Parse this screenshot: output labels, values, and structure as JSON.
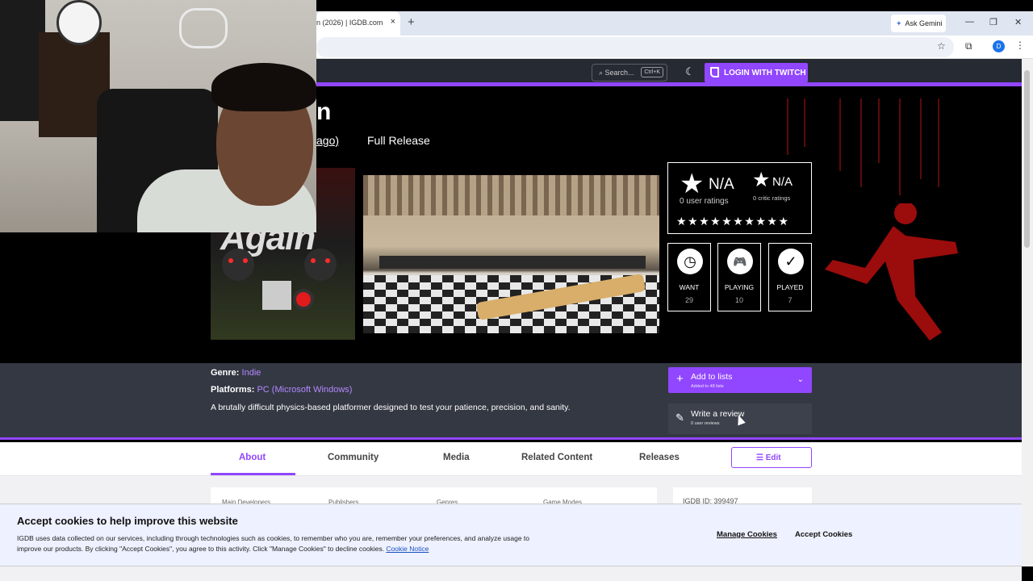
{
  "browser": {
    "tab_title": "n (2026) | IGDB.com",
    "tab_close": "×",
    "new_tab": "+",
    "gemini_label": "Ask Gemini",
    "minimize": "—",
    "restore": "❐",
    "close": "✕",
    "profile_initial": "D"
  },
  "header": {
    "search_placeholder": "Search...",
    "search_shortcut": "Ctrl+K",
    "login_label": "LOGIN WITH TWITCH"
  },
  "hero": {
    "title_fragment": "n",
    "release_fragment": "ago)",
    "release_status": "Full Release",
    "cover_text": "Again"
  },
  "ratings": {
    "user_score": "N/A",
    "user_count": "0 user ratings",
    "critic_score": "N/A",
    "critic_count": "0 critic ratings",
    "stars": "★★★★★★★★★★"
  },
  "stats": [
    {
      "label": "WANT",
      "count": "29",
      "icon": "◷"
    },
    {
      "label": "PLAYING",
      "count": "10",
      "icon": "🎮"
    },
    {
      "label": "PLAYED",
      "count": "7",
      "icon": "✓"
    }
  ],
  "info": {
    "genre_label": "Genre:",
    "genre_value": "Indie",
    "platforms_label": "Platforms:",
    "platforms_value": "PC (Microsoft Windows)",
    "description": "A brutally difficult physics-based platformer designed to test your patience, precision, and sanity.",
    "add_lists_label": "Add to lists",
    "add_lists_sub": "Added to 48 lists",
    "review_label": "Write a review",
    "review_sub": "0 user reviews"
  },
  "tabs": {
    "about": "About",
    "community": "Community",
    "media": "Media",
    "related": "Related Content",
    "releases": "Releases",
    "edit": "Edit"
  },
  "lower": {
    "col1": "Main Developers",
    "col2": "Publishers",
    "col3": "Genres",
    "col4": "Game Modes",
    "igdb_id": "IGDB ID: 399497"
  },
  "cookie": {
    "title": "Accept cookies to help improve this website",
    "text": "IGDB uses data collected on our services, including through technologies such as cookies, to remember who you are, remember your preferences, and analyze usage to improve our products. By clicking \"Accept Cookies\", you agree to this activity. Click \"Manage Cookies\" to decline cookies.",
    "notice_link": "Cookie Notice",
    "manage": "Manage Cookies",
    "accept": "Accept Cookies"
  },
  "colors": {
    "accent": "#9146ff",
    "header_bg": "#262a33",
    "info_bg": "#343843"
  }
}
